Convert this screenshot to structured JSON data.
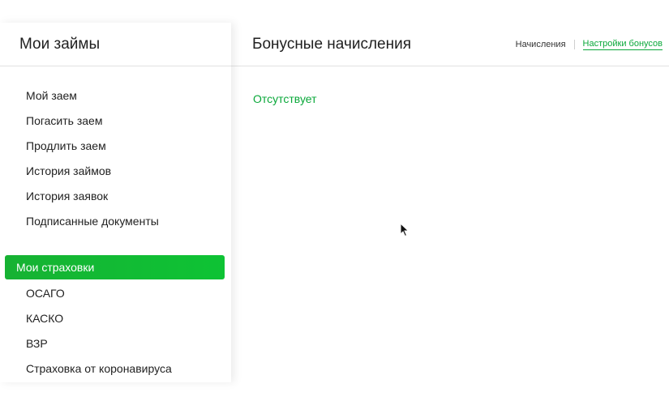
{
  "sidebar": {
    "title": "Мои займы",
    "loan_items": [
      {
        "label": "Мой заем"
      },
      {
        "label": "Погасить заем"
      },
      {
        "label": "Продлить заем"
      },
      {
        "label": "История займов"
      },
      {
        "label": "История заявок"
      },
      {
        "label": "Подписанные документы"
      }
    ],
    "insurance_section": {
      "label": "Мои страховки"
    },
    "insurance_items": [
      {
        "label": "ОСАГО"
      },
      {
        "label": "КАСКО"
      },
      {
        "label": "ВЗР"
      },
      {
        "label": "Страховка от коронавируса"
      }
    ]
  },
  "main": {
    "title": "Бонусные начисления",
    "tabs": [
      {
        "label": "Начисления"
      },
      {
        "label": "Настройки бонусов"
      }
    ],
    "status": "Отсутствует"
  },
  "colors": {
    "accent": "#0aa83a",
    "active_bg": "#16b233"
  },
  "icons": {
    "cursor": "mouse-pointer-icon"
  }
}
